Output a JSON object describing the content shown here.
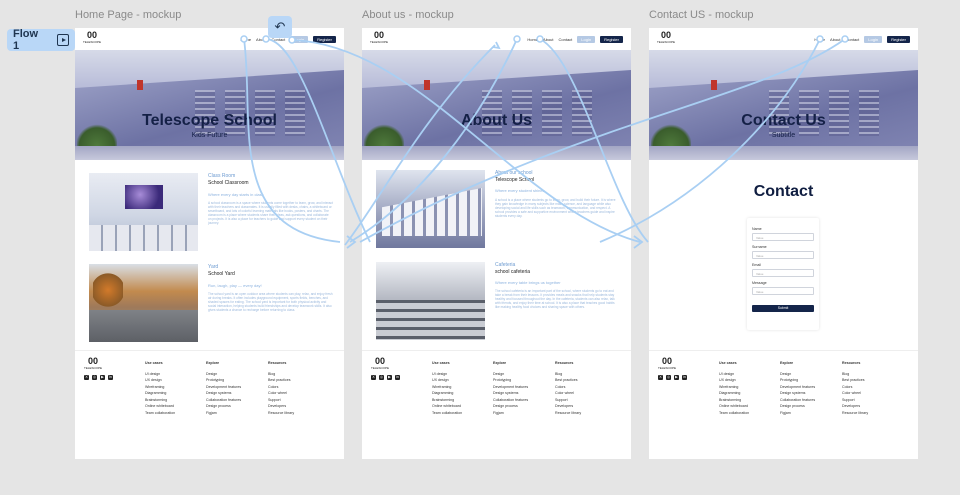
{
  "flow": {
    "label": "Flow 1",
    "icon": "play-frame-icon"
  },
  "frames": [
    {
      "title": "Home Page - mockup",
      "nav": {
        "links": [
          "Home",
          "About",
          "Contact"
        ],
        "login": "Login",
        "register": "Register"
      },
      "hero": {
        "title": "Telescope School",
        "subtitle": "Kids Future"
      },
      "sections": [
        {
          "title": "Class Room",
          "subtitle": "School Classroom",
          "tag": "Where every day starts in class",
          "body": "A school classroom is a space where students come together to learn, grow, and interact with their teachers and classmates. It is usually filled with desks, chairs, a whiteboard or smartboard, and lots of colorful learning materials like books, posters, and charts. The classroom is a place where students share their ideas, ask questions, and collaborate on projects. It is also a place for teachers to guide and support every student on their journey."
        },
        {
          "title": "Yard",
          "subtitle": "School Yard",
          "tag": "Run, laugh, play — every day!",
          "body": "The school yard is an open outdoor area where students can play, relax, and enjoy fresh air during breaks. It often includes playground equipment, sports fields, benches, and shaded spaces for eating. The school yard is important for both physical activity and social interaction, helping students build friendships and develop teamwork skills. It also gives students a chance to recharge before returning to class."
        }
      ]
    },
    {
      "title": "About us - mockup",
      "nav": {
        "links": [
          "Home",
          "About",
          "Contact"
        ],
        "login": "Login",
        "register": "Register"
      },
      "hero": {
        "title": "About Us",
        "subtitle": ""
      },
      "sections": [
        {
          "title": "About our school",
          "subtitle": "Telescope School",
          "tag": "Where every student shines",
          "body": "A school is a place where students go to learn, grow, and build their future. It is where they gain knowledge in many subjects like math, science, and language while also developing social and life skills such as teamwork, communication, and respect. A school provides a safe and supportive environment where teachers guide and inspire students every day."
        },
        {
          "title": "Cafeteria",
          "subtitle": "school cafeteria",
          "tag": "Where every table brings us together",
          "body": "The school cafeteria is an important part of the school, where students go to eat and take a break from their lessons. It provides meals and snacks that help students stay healthy and focused throughout the day. In the cafeteria, students can also relax, talk with friends, and enjoy their time at school. It is also a place that teaches good habits like making healthy food choices and sharing space with others."
        }
      ]
    },
    {
      "title": "Contact US - mockup",
      "nav": {
        "links": [
          "Home",
          "About",
          "Contact"
        ],
        "login": "Login",
        "register": "Register"
      },
      "hero": {
        "title": "Contact Us",
        "subtitle": "Subtitle"
      },
      "contact": {
        "title": "Contact",
        "fields": [
          {
            "label": "Name",
            "placeholder": "Value"
          },
          {
            "label": "Surname",
            "placeholder": "Value"
          },
          {
            "label": "Email",
            "placeholder": "Value"
          },
          {
            "label": "Message",
            "placeholder": "Value"
          }
        ],
        "submit": "Submit"
      }
    }
  ],
  "footer": {
    "columns": [
      {
        "heading": "Use cases",
        "items": [
          "UI design",
          "UX design",
          "Wireframing",
          "Diagramming",
          "Brainstorming",
          "Online whiteboard",
          "Team collaboration"
        ]
      },
      {
        "heading": "Explore",
        "items": [
          "Design",
          "Prototyping",
          "Development features",
          "Design systems",
          "Collaboration features",
          "Design process",
          "Figjam"
        ]
      },
      {
        "heading": "Resources",
        "items": [
          "Blog",
          "Best practices",
          "Colors",
          "Color wheel",
          "Support",
          "Developers",
          "Resource library"
        ]
      }
    ],
    "socials": [
      "x-icon",
      "instagram-icon",
      "youtube-icon",
      "linkedin-icon"
    ]
  }
}
